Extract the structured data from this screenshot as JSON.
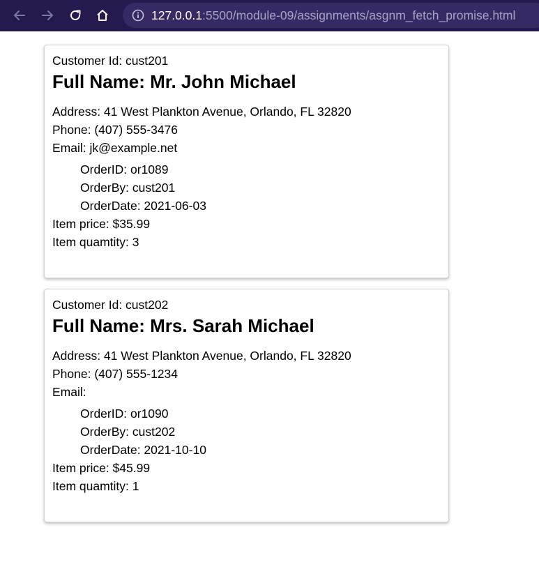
{
  "browser": {
    "url_host": "127.0.0.1",
    "url_rest": ":5500/module-09/assignments/asgnm_fetch_promise.html"
  },
  "customers": [
    {
      "customer_id_label": "Customer Id: cust201",
      "full_name": "Full Name: Mr. John Michael",
      "address": "Address: 41 West Plankton Avenue, Orlando, FL 32820",
      "phone": "Phone: (407) 555-3476",
      "email": "Email: jk@example.net",
      "order_id": "OrderID: or1089",
      "order_by": "OrderBy: cust201",
      "order_date": "OrderDate: 2021-06-03",
      "item_price": "Item price: $35.99",
      "item_quantity": "Item quamtity: 3"
    },
    {
      "customer_id_label": "Customer Id: cust202",
      "full_name": "Full Name: Mrs. Sarah Michael",
      "address": "Address: 41 West Plankton Avenue, Orlando, FL 32820",
      "phone": "Phone: (407) 555-1234",
      "email": "Email:",
      "order_id": "OrderID: or1090",
      "order_by": "OrderBy: cust202",
      "order_date": "OrderDate: 2021-10-10",
      "item_price": "Item price: $45.99",
      "item_quantity": "Item quamtity: 1"
    }
  ]
}
